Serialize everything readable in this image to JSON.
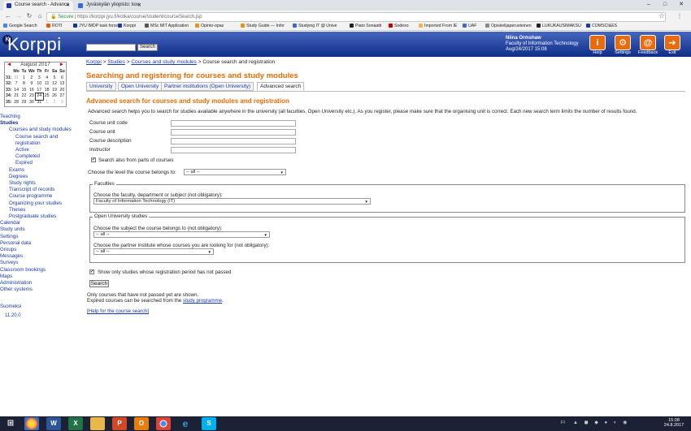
{
  "browser": {
    "tabs": [
      {
        "title": "Course search - Advance",
        "active": true
      },
      {
        "title": "Jyväskylän yliopisto: kou",
        "active": false
      }
    ],
    "window_controls": {
      "minimize": "–",
      "maximize": "□",
      "close": "✕"
    },
    "address": {
      "secure_label": "Secure",
      "host": "https://korppi.jyu.fi",
      "path": "/kotka/course/student/courseSearch.jsp"
    },
    "bookmarks": [
      "Google Search",
      "ROTI",
      "JYU IMDP task force",
      "Korppi",
      "MSc MIT Application",
      "Opinto-opas",
      "Study Guide — Infor",
      "Studying IT @ Unive",
      "Piato Sonaatti",
      "Sodexo",
      "Imported From IE",
      "UAF",
      "Opiskelijaperusteinen",
      "LUKUKAUSIMAKSU",
      "COMSCI&ES"
    ]
  },
  "header": {
    "logo_text": "Korppi",
    "logo_badge": "K",
    "search_button": "Search",
    "user_name": "Niina Ormshaw",
    "user_faculty": "Faculty of Information Technology",
    "user_datetime": "Aug/24/2017 15:08",
    "toolbar": [
      {
        "label": "Help",
        "glyph": "i",
        "icon": "help-icon"
      },
      {
        "label": "Settings",
        "glyph": "⚙",
        "icon": "settings-icon"
      },
      {
        "label": "Feedback",
        "glyph": "@",
        "icon": "feedback-icon"
      },
      {
        "label": "Exit",
        "glyph": "➜",
        "icon": "exit-icon"
      }
    ]
  },
  "calendar": {
    "month": "August 2017",
    "prev": "◄",
    "next": "►",
    "day_headers": [
      "Mo",
      "Tu",
      "We",
      "Th",
      "Fr",
      "Sa",
      "Su"
    ],
    "weeks": [
      {
        "wk": "31:",
        "days": [
          "31",
          "1",
          "2",
          "3",
          "4",
          "5",
          "6"
        ]
      },
      {
        "wk": "32:",
        "days": [
          "7",
          "8",
          "9",
          "10",
          "11",
          "12",
          "13"
        ]
      },
      {
        "wk": "33:",
        "days": [
          "14",
          "15",
          "16",
          "17",
          "18",
          "19",
          "20"
        ]
      },
      {
        "wk": "34:",
        "days": [
          "21",
          "22",
          "23",
          "24",
          "25",
          "26",
          "27"
        ]
      },
      {
        "wk": "35:",
        "days": [
          "28",
          "29",
          "30",
          "31",
          "1",
          "2",
          "3"
        ]
      }
    ],
    "today": "24"
  },
  "sidebar": [
    {
      "label": "Teaching",
      "level": 0,
      "bold": false
    },
    {
      "label": "Studies",
      "level": 0,
      "bold": true
    },
    {
      "label": "Courses and study modules",
      "level": 1,
      "bold": false
    },
    {
      "label": "Course search and",
      "level": 2,
      "bold": false
    },
    {
      "label": "registration",
      "level": 2,
      "bold": false
    },
    {
      "label": "Active",
      "level": 2,
      "bold": false
    },
    {
      "label": "Completed",
      "level": 2,
      "bold": false
    },
    {
      "label": "Expired",
      "level": 2,
      "bold": false
    },
    {
      "label": "Exams",
      "level": 1,
      "bold": false
    },
    {
      "label": "Degrees",
      "level": 1,
      "bold": false
    },
    {
      "label": "Study rights",
      "level": 1,
      "bold": false
    },
    {
      "label": "Transcript of records",
      "level": 1,
      "bold": false
    },
    {
      "label": "Course programme",
      "level": 1,
      "bold": false
    },
    {
      "label": "Organizing your studies",
      "level": 1,
      "bold": false
    },
    {
      "label": "Theses",
      "level": 1,
      "bold": false
    },
    {
      "label": "Postgraduate studies",
      "level": 1,
      "bold": false
    },
    {
      "label": "Calendar",
      "level": 0,
      "bold": false
    },
    {
      "label": "Study units",
      "level": 0,
      "bold": false
    },
    {
      "label": "Settings",
      "level": 0,
      "bold": false
    },
    {
      "label": "Personal data",
      "level": 0,
      "bold": false
    },
    {
      "label": "Groups",
      "level": 0,
      "bold": false
    },
    {
      "label": "Messages",
      "level": 0,
      "bold": false
    },
    {
      "label": "Surveys",
      "level": 0,
      "bold": false
    },
    {
      "label": "Classroom bookings",
      "level": 0,
      "bold": false
    },
    {
      "label": "Maps",
      "level": 0,
      "bold": false
    },
    {
      "label": "Administration",
      "level": 0,
      "bold": false
    },
    {
      "label": "Other systems",
      "level": 0,
      "bold": false
    }
  ],
  "sidebar_footer": {
    "language": "Suomeksi",
    "version": "11.20.0"
  },
  "main": {
    "breadcrumb": [
      "Korppi",
      "Studies",
      "Courses and study modules",
      "Course search and registration"
    ],
    "breadcrumb_sep": " > ",
    "title": "Searching and registering for courses and study modules",
    "tabs": [
      "University",
      "Open University",
      "Partner institutions (Open University)",
      "Advanced search"
    ],
    "section_title": "Advanced search for courses and study modules and registration",
    "intro": "Advanced search helps you to search for studies available anywhere in the university (all faculties, Open University etc.). As you register, please make sure that the organising unit is correct. Each new search term limits the number of results found.",
    "fields": [
      "Course unit code",
      "Course unit",
      "Course description",
      "Instructor"
    ],
    "search_parts_label": "Search also from parts of courses",
    "level_label": "Choose the level the course belongs to:",
    "level_value": "-- all --",
    "faculties": {
      "legend": "Faculties",
      "label": "Choose the faculty, department or subject (not obligatory):",
      "value": "Faculty of Information Technology (IT)"
    },
    "open_univ": {
      "legend": "Open University studies",
      "subject_label": "Choose the subject the course belongs to (not obligatory):",
      "subject_value": "-- all --",
      "partner_label": "Choose the partner institute whose courses you are looking for (not obligatory):",
      "partner_value": "-- all --"
    },
    "only_open_label": "Show only studies whose registration period has not passed",
    "search_button": "Search",
    "note1": "Only courses that have not passed yet are shown.",
    "note2_prefix": "Expired courses can be searched from the ",
    "note2_link": "study programme",
    "note2_suffix": ".",
    "help_link": "[Help for the course search]"
  },
  "taskbar": {
    "clock_time": "15:08",
    "clock_date": "24.8.2017",
    "lang": "FI"
  }
}
